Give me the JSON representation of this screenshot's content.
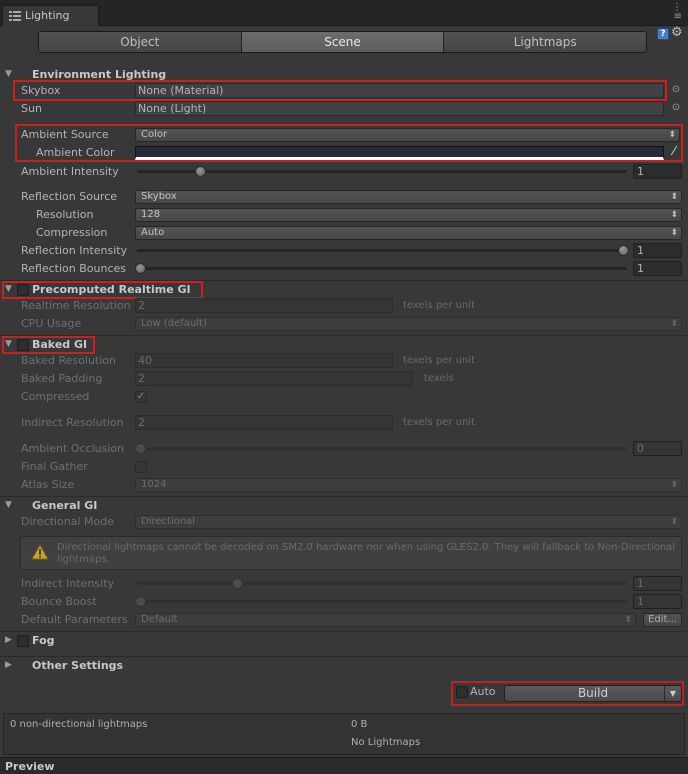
{
  "window": {
    "tab_title": "Lighting",
    "tab_icon": "lighting-list-icon",
    "menu_icon": "window-menu-icon"
  },
  "tabs": [
    {
      "label": "Object",
      "active": false
    },
    {
      "label": "Scene",
      "active": true
    },
    {
      "label": "Lightmaps",
      "active": false
    }
  ],
  "environment": {
    "title": "Environment Lighting",
    "skybox_label": "Skybox",
    "skybox_value": "None (Material)",
    "sun_label": "Sun",
    "sun_value": "None (Light)",
    "ambient_source_label": "Ambient Source",
    "ambient_source_value": "Color",
    "ambient_color_label": "Ambient Color",
    "ambient_intensity_label": "Ambient Intensity",
    "ambient_intensity_value": "1",
    "ambient_intensity_fraction": 0.125,
    "reflection_source_label": "Reflection Source",
    "reflection_source_value": "Skybox",
    "resolution_label": "Resolution",
    "resolution_value": "128",
    "compression_label": "Compression",
    "compression_value": "Auto",
    "reflection_intensity_label": "Reflection Intensity",
    "reflection_intensity_value": "1",
    "reflection_intensity_fraction": 1.0,
    "reflection_bounces_label": "Reflection Bounces",
    "reflection_bounces_value": "1",
    "reflection_bounces_fraction": 0.0
  },
  "precomputed": {
    "title": "Precomputed Realtime GI",
    "realtime_resolution_label": "Realtime Resolution",
    "realtime_resolution_value": "2",
    "realtime_resolution_unit": "texels per unit",
    "cpu_usage_label": "CPU Usage",
    "cpu_usage_value": "Low (default)"
  },
  "baked": {
    "title": "Baked GI",
    "baked_resolution_label": "Baked Resolution",
    "baked_resolution_value": "40",
    "baked_resolution_unit": "texels per unit",
    "baked_padding_label": "Baked Padding",
    "baked_padding_value": "2",
    "baked_padding_unit": "texels",
    "compressed_label": "Compressed",
    "compressed_check": "✓",
    "indirect_resolution_label": "Indirect Resolution",
    "indirect_resolution_value": "2",
    "indirect_resolution_unit": "texels per unit",
    "ambient_occlusion_label": "Ambient Occlusion",
    "ambient_occlusion_value": "0",
    "ambient_occlusion_fraction": 0.0,
    "final_gather_label": "Final Gather",
    "atlas_size_label": "Atlas Size",
    "atlas_size_value": "1024"
  },
  "general": {
    "title": "General GI",
    "directional_mode_label": "Directional Mode",
    "directional_mode_value": "Directional",
    "warning_text": "Directional lightmaps cannot be decoded on SM2.0 hardware nor when using GLES2.0. They will fallback to Non-Directional lightmaps.",
    "indirect_intensity_label": "Indirect Intensity",
    "indirect_intensity_value": "1",
    "indirect_intensity_fraction": 0.2,
    "bounce_boost_label": "Bounce Boost",
    "bounce_boost_value": "1",
    "bounce_boost_fraction": 0.0,
    "default_parameters_label": "Default Parameters",
    "default_parameters_value": "Default",
    "edit_label": "Edit..."
  },
  "fog": {
    "title": "Fog"
  },
  "other": {
    "title": "Other Settings"
  },
  "build": {
    "auto_label": "Auto",
    "build_label": "Build"
  },
  "stats": {
    "lightmaps_count": "0 non-directional lightmaps",
    "size": "0 B",
    "status": "No Lightmaps"
  },
  "preview": {
    "title": "Preview"
  },
  "colors": {
    "highlight": "#cc2020",
    "ambient_color": "#252a36"
  }
}
